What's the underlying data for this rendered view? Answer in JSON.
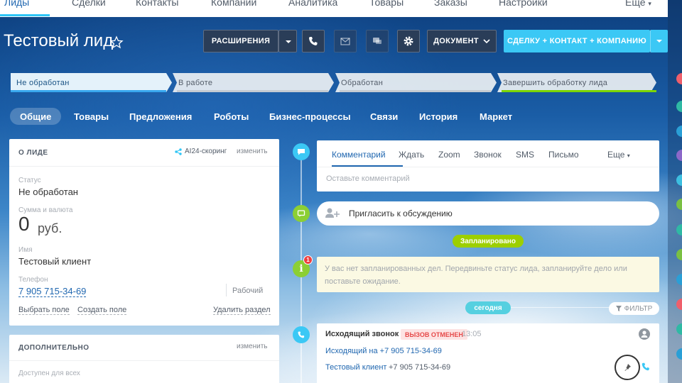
{
  "topnav": {
    "items": [
      "Лиды",
      "Сделки",
      "Контакты",
      "Компании",
      "Аналитика",
      "Товары",
      "Заказы",
      "Настройки"
    ],
    "more": "Еще"
  },
  "header": {
    "title": "Тестовый лид",
    "extensions_label": "РАСШИРЕНИЯ",
    "document_label": "ДОКУМЕНТ",
    "convert_label": "СДЕЛКУ + КОНТАКТ + КОМПАНИЮ"
  },
  "stages": [
    {
      "label": "Не обработан",
      "color": "#39a8ef"
    },
    {
      "label": "В работе",
      "color": "#d3d7dc"
    },
    {
      "label": "Обработан",
      "color": "#d3d7dc"
    },
    {
      "label": "Завершить обработку лида",
      "color": "#7bd500"
    }
  ],
  "tabs": [
    "Общие",
    "Товары",
    "Предложения",
    "Роботы",
    "Бизнес-процессы",
    "Связи",
    "История",
    "Маркет"
  ],
  "about": {
    "title": "О ЛИДЕ",
    "scoring": "AI24-скоринг",
    "edit": "изменить",
    "status_label": "Статус",
    "status_value": "Не обработан",
    "amount_label": "Сумма и валюта",
    "amount_value": "0",
    "currency": "руб.",
    "name_label": "Имя",
    "name_value": "Тестовый клиент",
    "phone_label": "Телефон",
    "phone_value": "7 905 715-34-69",
    "phone_type": "Рабочий",
    "select_field": "Выбрать поле",
    "create_field": "Создать поле",
    "delete_section": "Удалить раздел"
  },
  "additional": {
    "title": "ДОПОЛНИТЕЛЬНО",
    "edit": "изменить",
    "available_label": "Доступен для всех"
  },
  "composer": {
    "tabs": [
      "Комментарий",
      "Ждать",
      "Zoom",
      "Звонок",
      "SMS",
      "Письмо"
    ],
    "more": "Еще",
    "placeholder": "Оставьте комментарий"
  },
  "invite": {
    "text": "Пригласить к обсуждению"
  },
  "planned": {
    "badge": "Запланировано",
    "notice_count": "1",
    "notice": "У вас нет запланированных дел. Передвиньте статус лида, запланируйте дело или поставьте ожидание."
  },
  "today": {
    "badge": "сегодня",
    "filter": "ФИЛЬТР"
  },
  "call": {
    "title": "Исходящий звонок",
    "status": "вызов отменен",
    "time": "13:05",
    "line1": "Исходящий на +7 905 715-34-69",
    "client": "Тестовый клиент",
    "client_phone": "+7 905 715-34-69"
  },
  "colors": {
    "accent": "#3bc8f5",
    "dark_button": "#2a3d58",
    "planned_green": "#9dcf00",
    "today_blue": "#55d0e0",
    "call_status_red": "#f4a3a3"
  }
}
